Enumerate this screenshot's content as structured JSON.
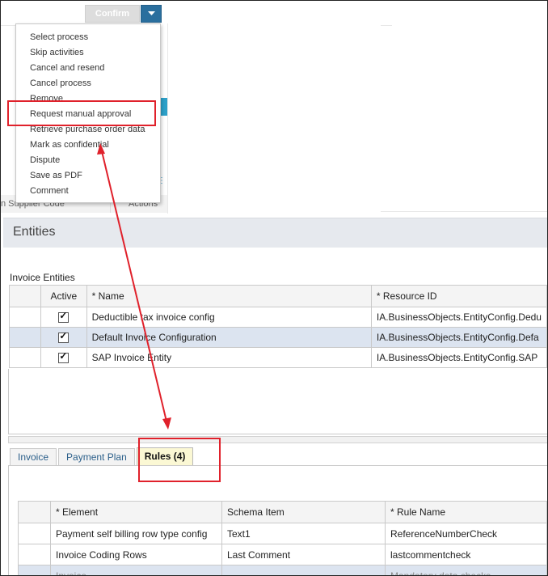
{
  "toolbar": {
    "confirm_label": "Confirm"
  },
  "menu": {
    "items": [
      {
        "label": "Select process"
      },
      {
        "label": "Skip activities"
      },
      {
        "label": "Cancel and resend"
      },
      {
        "label": "Cancel process"
      },
      {
        "label": "Remove"
      },
      {
        "label": "Request manual approval"
      },
      {
        "label": "Retrieve purchase order data"
      },
      {
        "label": "Mark as confidential"
      },
      {
        "label": "Dispute"
      },
      {
        "label": "Save as PDF"
      },
      {
        "label": "Comment"
      }
    ]
  },
  "background": {
    "supplier_code_col": "n Supplier Code",
    "actions_col": "Actions"
  },
  "entities": {
    "title": "Entities",
    "section_label": "Invoice Entities",
    "columns": [
      "",
      "Active",
      "* Name",
      "* Resource ID"
    ],
    "rows": [
      {
        "name": "Deductible tax invoice config",
        "resource_id": "IA.BusinessObjects.EntityConfig.Dedu",
        "active": true
      },
      {
        "name": "Default Invoice Configuration",
        "resource_id": "IA.BusinessObjects.EntityConfig.Defa",
        "active": true
      },
      {
        "name": "SAP Invoice Entity",
        "resource_id": "IA.BusinessObjects.EntityConfig.SAP",
        "active": true
      }
    ]
  },
  "tabs": [
    {
      "label": "Invoice"
    },
    {
      "label": "Payment Plan"
    },
    {
      "label": "Rules (4)"
    }
  ],
  "rules": {
    "columns": [
      "",
      "* Element",
      "Schema Item",
      "* Rule Name"
    ],
    "rows": [
      {
        "element": "Payment self billing row type config",
        "schema_item": "Text1",
        "rule_name": "ReferenceNumberCheck"
      },
      {
        "element": "Invoice Coding Rows",
        "schema_item": "Last Comment",
        "rule_name": "lastcommentcheck"
      },
      {
        "element": "Invoice",
        "schema_item": "",
        "rule_name": "Mandatory data checks"
      }
    ]
  },
  "annotation_color": "#e0212b",
  "accent": "#2a6f9e"
}
